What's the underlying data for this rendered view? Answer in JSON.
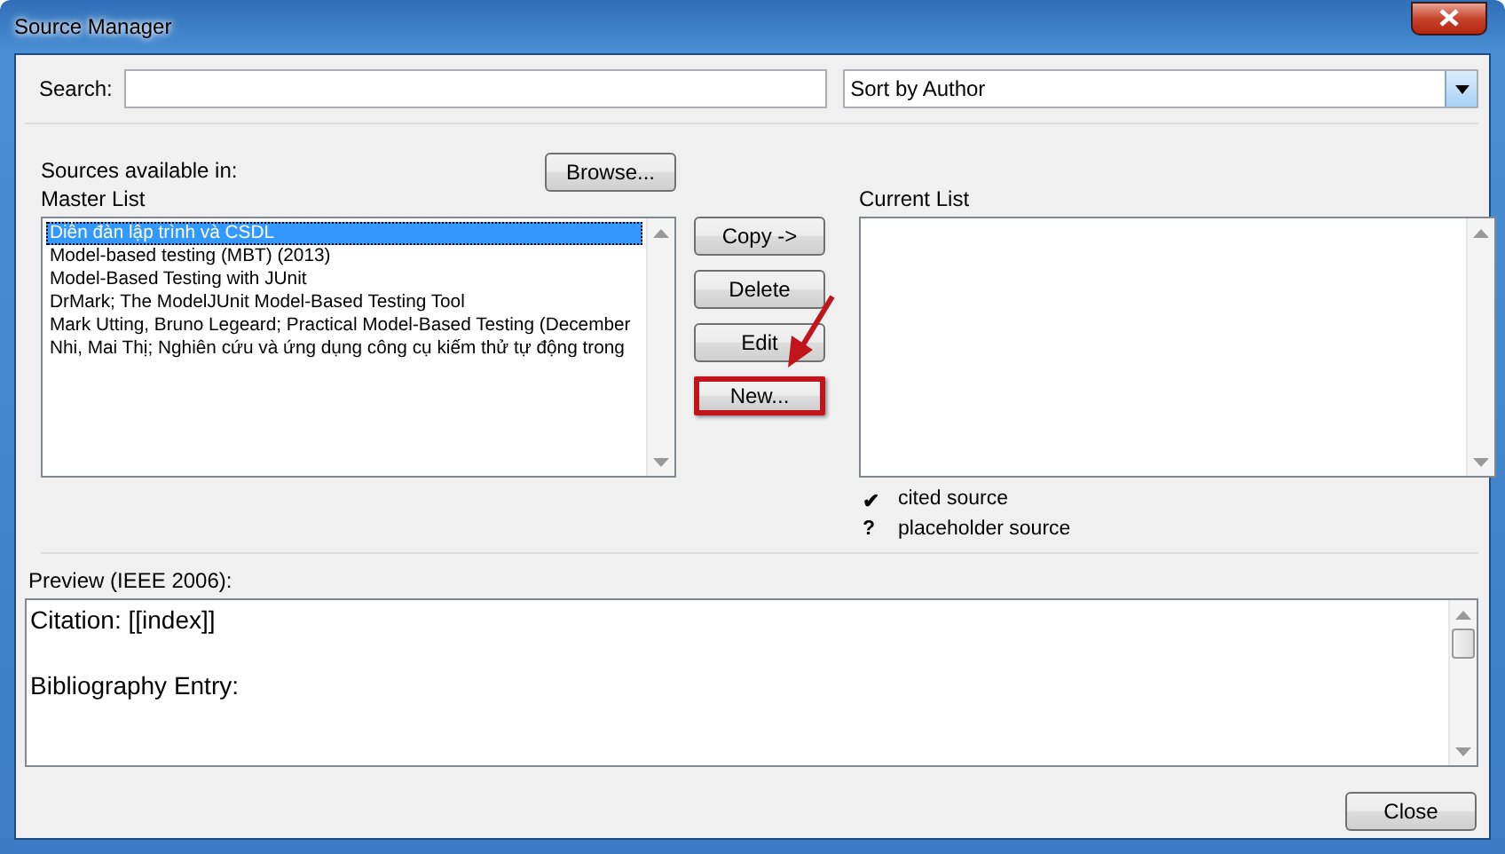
{
  "window": {
    "title": "Source Manager"
  },
  "search": {
    "label": "Search:"
  },
  "sort": {
    "value": "Sort by Author"
  },
  "sources_label": "Sources available in:",
  "browse_button": {
    "label": "Browse..."
  },
  "master_list": {
    "label": "Master List",
    "items": [
      {
        "text": "Diễn đàn lập trình và CSDL",
        "selected": true
      },
      {
        "text": "Model-based testing (MBT) (2013)",
        "selected": false
      },
      {
        "text": "Model-Based Testing with JUnit",
        "selected": false
      },
      {
        "text": "DrMark; The ModelJUnit Model-Based Testing Tool",
        "selected": false
      },
      {
        "text": "Mark Utting, Bruno Legeard; Practical Model-Based Testing (December",
        "selected": false
      },
      {
        "text": "Nhi, Mai Thị; Nghiên cứu và ứng dụng công cụ kiếm thử tự động trong",
        "selected": false
      }
    ]
  },
  "actions": [
    {
      "label": "Copy ->",
      "highlighted": false
    },
    {
      "label": "Delete",
      "highlighted": false
    },
    {
      "label": "Edit",
      "highlighted": false
    },
    {
      "label": "New...",
      "highlighted": true
    }
  ],
  "current_list": {
    "label": "Current List"
  },
  "legend": [
    {
      "symbol": "✔",
      "label": "cited source"
    },
    {
      "symbol": "?",
      "label": "placeholder source"
    }
  ],
  "preview": {
    "label": "Preview (IEEE 2006):",
    "lines": [
      "Citation:  [[index]]",
      "Bibliography Entry:"
    ]
  },
  "close_button": {
    "label": "Close"
  }
}
